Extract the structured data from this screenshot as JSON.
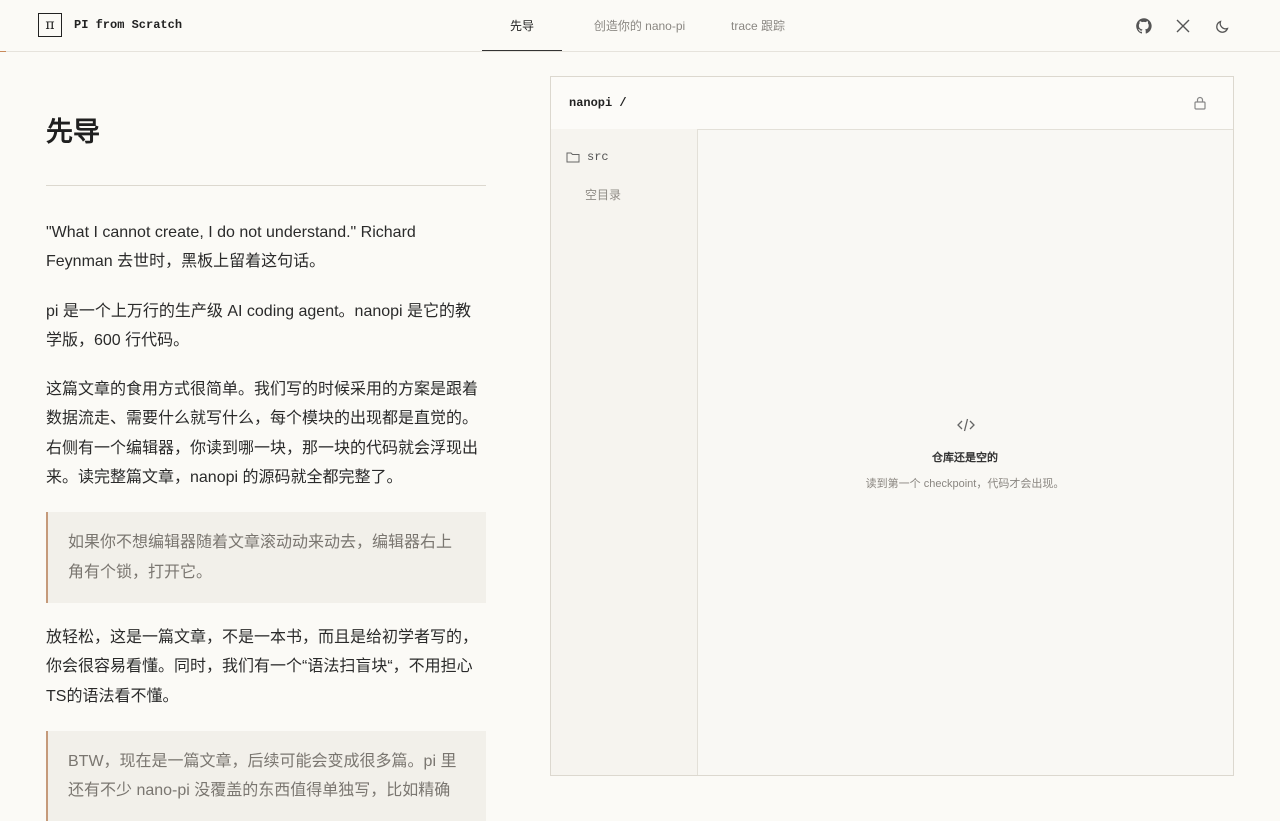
{
  "header": {
    "logo_glyph": "π",
    "brand": "PI from Scratch",
    "tabs": [
      {
        "label": "先导",
        "active": true
      },
      {
        "label": "创造你的 nano-pi",
        "active": false
      },
      {
        "label": "trace 跟踪",
        "active": false
      }
    ],
    "icons": [
      "github-icon",
      "x-icon",
      "moon-icon"
    ]
  },
  "article": {
    "title": "先导",
    "paragraphs": [
      "\"What I cannot create, I do not understand.\" Richard Feynman 去世时，黑板上留着这句话。",
      "pi 是一个上万行的生产级 AI coding agent。nanopi 是它的教学版，600 行代码。",
      "这篇文章的食用方式很简单。我们写的时候采用的方案是跟着数据流走、需要什么就写什么，每个模块的出现都是直觉的。右侧有一个编辑器，你读到哪一块，那一块的代码就会浮现出来。读完整篇文章，nanopi 的源码就全都完整了。",
      "放轻松，这是一篇文章，不是一本书，而且是给初学者写的，你会很容易看懂。同时，我们有一个“语法扫盲块“，不用担心TS的语法看不懂。"
    ],
    "quotes": [
      "如果你不想编辑器随着文章滚动动来动去，编辑器右上角有个锁，打开它。",
      "BTW，现在是一篇文章，后续可能会变成很多篇。pi 里还有不少 nano-pi 没覆盖的东西值得单独写，比如精确"
    ]
  },
  "editor": {
    "repo": "nanopi /",
    "folder": "src",
    "empty_dir": "空目录",
    "empty_title": "仓库还是空的",
    "empty_subtitle": "读到第一个 checkpoint，代码才会出现。"
  },
  "colors": {
    "background": "#fbfaf6",
    "accent": "#c59a7a",
    "text": "#222222"
  }
}
